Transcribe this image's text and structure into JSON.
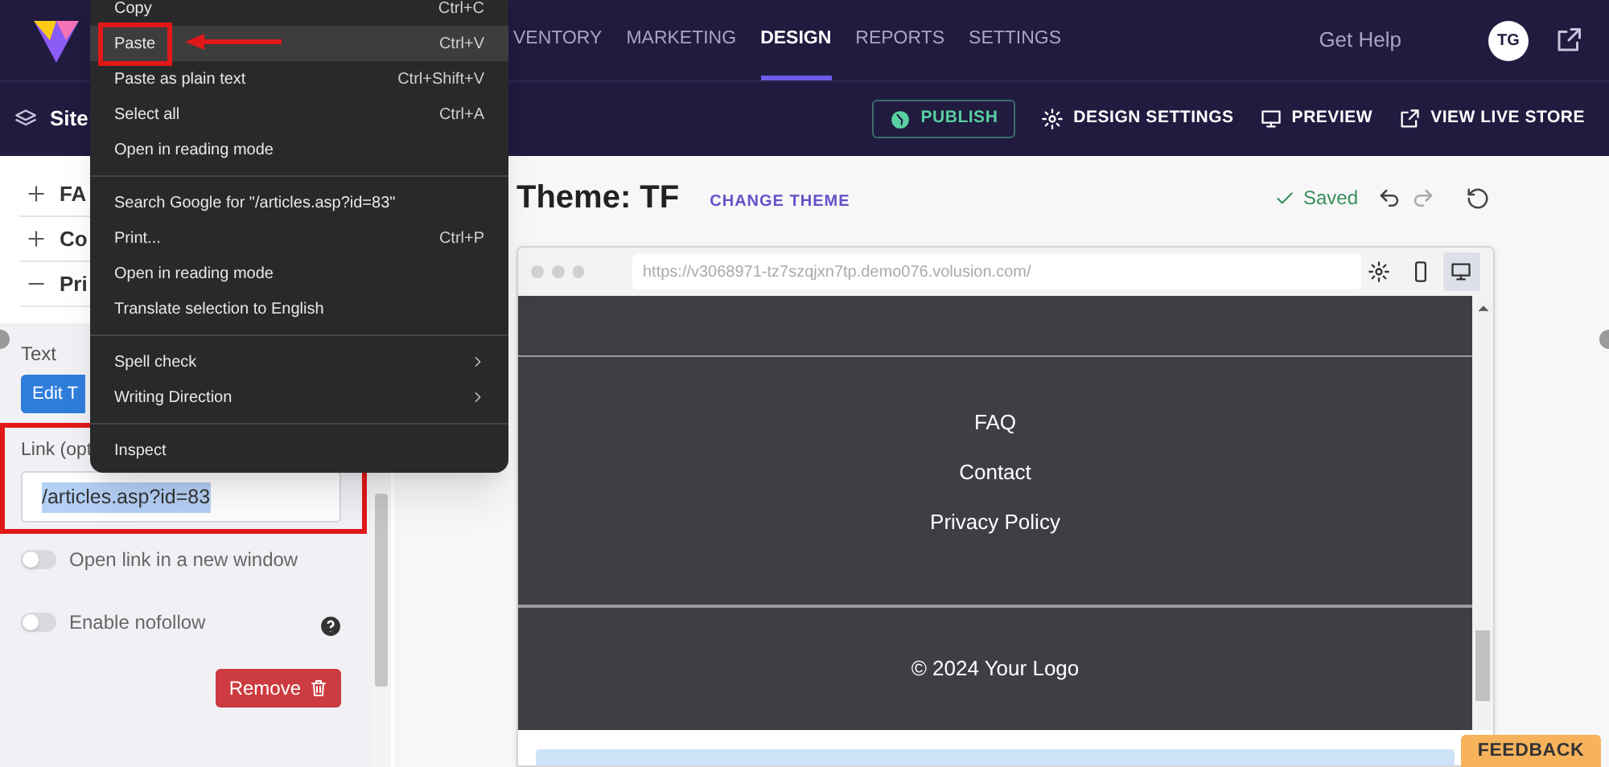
{
  "top_nav": {
    "items": [
      {
        "label": "VENTORY",
        "selected": false
      },
      {
        "label": "MARKETING",
        "selected": false
      },
      {
        "label": "DESIGN",
        "selected": true
      },
      {
        "label": "REPORTS",
        "selected": false
      },
      {
        "label": "SETTINGS",
        "selected": false
      }
    ],
    "help": "Get Help",
    "avatar": "TG"
  },
  "toolbar": {
    "site_label": "Site",
    "publish": "PUBLISH",
    "actions": [
      "DESIGN SETTINGS",
      "PREVIEW",
      "VIEW LIVE STORE"
    ]
  },
  "sidebar": {
    "sections": [
      {
        "label": "FA",
        "expanded": false
      },
      {
        "label": "Co",
        "expanded": false
      },
      {
        "label": "Pri",
        "expanded": true
      }
    ],
    "text_label": "Text",
    "edit_button": "Edit T",
    "link_label": "Link (opt",
    "link_value": "/articles.asp?id=83",
    "toggles": [
      {
        "label": "Open link in a new window",
        "on": false,
        "help": false
      },
      {
        "label": "Enable nofollow",
        "on": false,
        "help": true
      }
    ],
    "remove_button": "Remove"
  },
  "editor": {
    "title": "Theme: TF",
    "change_theme": "CHANGE THEME",
    "status": "Saved",
    "preview": {
      "url": "https://v3068971-tz7szqjxn7tp.demo076.volusion.com/",
      "devices": [
        {
          "kind": "settings",
          "selected": false
        },
        {
          "kind": "mobile",
          "selected": false
        },
        {
          "kind": "desktop",
          "selected": true
        }
      ],
      "footer_links": [
        "FAQ",
        "Contact",
        "Privacy Policy"
      ],
      "copyright": "© 2024 Your Logo"
    }
  },
  "feedback": "FEEDBACK",
  "context_menu": {
    "groups": [
      [
        {
          "label": "Copy",
          "shortcut": "Ctrl+C",
          "selected": false,
          "submenu": false
        },
        {
          "label": "Paste",
          "shortcut": "Ctrl+V",
          "selected": true,
          "submenu": false
        },
        {
          "label": "Paste as plain text",
          "shortcut": "Ctrl+Shift+V",
          "selected": false,
          "submenu": false
        },
        {
          "label": "Select all",
          "shortcut": "Ctrl+A",
          "selected": false,
          "submenu": false
        },
        {
          "label": "Open in reading mode",
          "selected": false,
          "submenu": false
        }
      ],
      [
        {
          "label": "Search Google for \"/articles.asp?id=83\"",
          "selected": false,
          "submenu": false
        },
        {
          "label": "Print...",
          "shortcut": "Ctrl+P",
          "selected": false,
          "submenu": false
        },
        {
          "label": "Open in reading mode",
          "selected": false,
          "submenu": false
        },
        {
          "label": "Translate selection to English",
          "selected": false,
          "submenu": false
        }
      ],
      [
        {
          "label": "Spell check",
          "selected": false,
          "submenu": true
        },
        {
          "label": "Writing Direction",
          "selected": false,
          "submenu": true
        }
      ],
      [
        {
          "label": "Inspect",
          "selected": false,
          "submenu": false
        }
      ]
    ]
  }
}
